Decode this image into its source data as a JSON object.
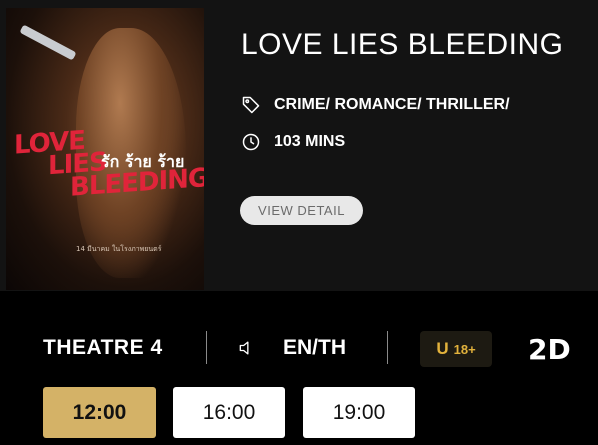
{
  "movie": {
    "title": "LOVE LIES BLEEDING",
    "genres": "CRIME/ ROMANCE/ THRILLER/",
    "duration": "103 MINS",
    "view_detail_label": "VIEW DETAIL",
    "poster": {
      "title_lines": [
        "LOVE",
        "LIES",
        "BLEEDING"
      ],
      "thai_title": "รัก ร้าย ร้าย",
      "release_note": "14 มีนาคม ในโรงภาพยนตร์"
    }
  },
  "session": {
    "theatre": "THEATRE 4",
    "language": "EN/TH",
    "rating_letter": "U",
    "rating_age": "18+",
    "format": "2D"
  },
  "showtimes": [
    {
      "time": "12:00",
      "selected": true
    },
    {
      "time": "16:00",
      "selected": false
    },
    {
      "time": "19:00",
      "selected": false
    }
  ],
  "colors": {
    "selected_showtime": "#d4b267",
    "rating_gold": "#e2b23c",
    "card_background": "#131313"
  },
  "icons": {
    "genre": "tag-icon",
    "duration": "clock-icon",
    "language": "speaker-icon"
  }
}
